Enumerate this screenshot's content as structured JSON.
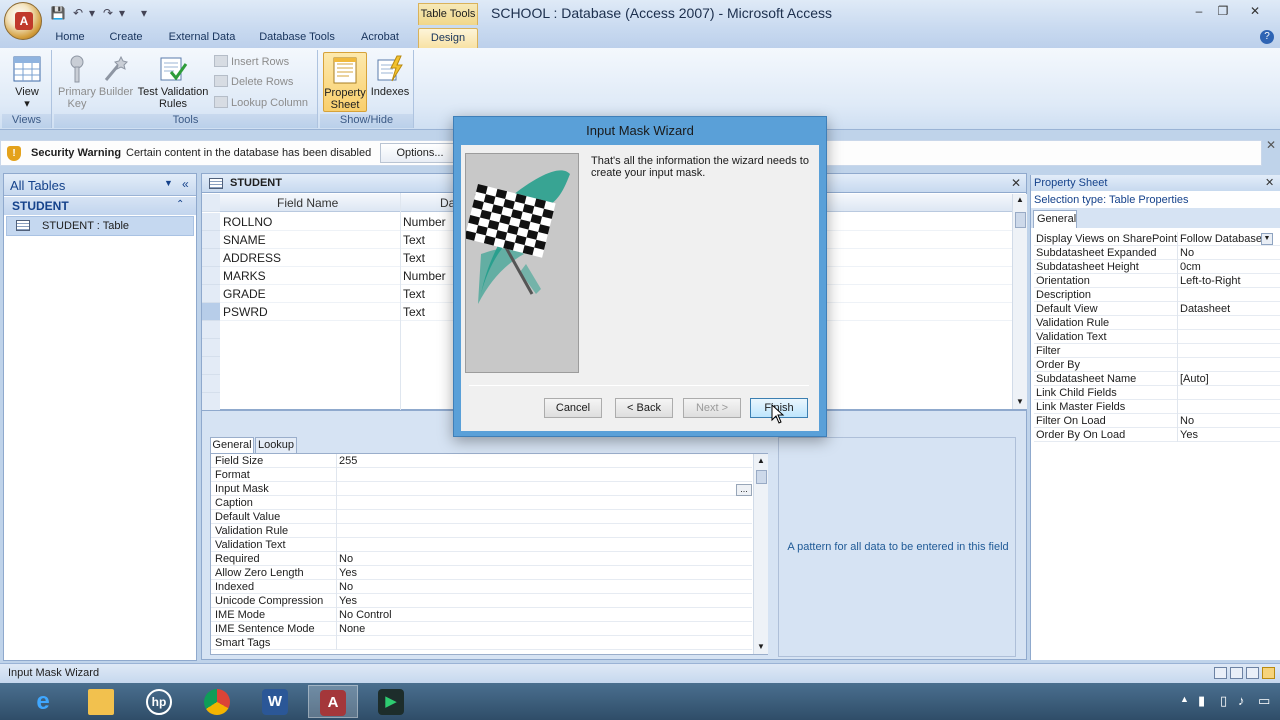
{
  "window": {
    "title": "SCHOOL : Database (Access 2007) - Microsoft Access",
    "context_tab_group": "Table Tools",
    "controls": {
      "minimize": "–",
      "restore": "❐",
      "close": "✕"
    }
  },
  "ribbon": {
    "tabs": [
      "Home",
      "Create",
      "External Data",
      "Database Tools",
      "Acrobat",
      "Design"
    ],
    "active_tab": "Design",
    "groups": {
      "views": {
        "label": "Views",
        "view_button": "View"
      },
      "tools": {
        "label": "Tools",
        "primary_key": [
          "Primary",
          "Key"
        ],
        "builder": "Builder",
        "test_validation": [
          "Test Validation",
          "Rules"
        ],
        "insert_rows": "Insert Rows",
        "delete_rows": "Delete Rows",
        "lookup_column": "Lookup Column"
      },
      "show_hide": {
        "label": "Show/Hide",
        "property_sheet": [
          "Property",
          "Sheet"
        ],
        "indexes": "Indexes"
      }
    }
  },
  "security_bar": {
    "title": "Security Warning",
    "message": "Certain content in the database has been disabled",
    "options_button": "Options..."
  },
  "nav_pane": {
    "title": "All Tables",
    "group": "STUDENT",
    "item": "STUDENT : Table"
  },
  "document": {
    "tab_label": "STUDENT",
    "columns": [
      "Field Name",
      "Da"
    ],
    "rows": [
      {
        "name": "ROLLNO",
        "type": "Number"
      },
      {
        "name": "SNAME",
        "type": "Text"
      },
      {
        "name": "ADDRESS",
        "type": "Text"
      },
      {
        "name": "MARKS",
        "type": "Number"
      },
      {
        "name": "GRADE",
        "type": "Text"
      },
      {
        "name": "PSWRD",
        "type": "Text"
      }
    ]
  },
  "field_properties": {
    "tabs": [
      "General",
      "Lookup"
    ],
    "rows": [
      {
        "name": "Field Size",
        "value": "255"
      },
      {
        "name": "Format",
        "value": ""
      },
      {
        "name": "Input Mask",
        "value": ""
      },
      {
        "name": "Caption",
        "value": ""
      },
      {
        "name": "Default Value",
        "value": ""
      },
      {
        "name": "Validation Rule",
        "value": ""
      },
      {
        "name": "Validation Text",
        "value": ""
      },
      {
        "name": "Required",
        "value": "No"
      },
      {
        "name": "Allow Zero Length",
        "value": "Yes"
      },
      {
        "name": "Indexed",
        "value": "No"
      },
      {
        "name": "Unicode Compression",
        "value": "Yes"
      },
      {
        "name": "IME Mode",
        "value": "No Control"
      },
      {
        "name": "IME Sentence Mode",
        "value": "None"
      },
      {
        "name": "Smart Tags",
        "value": ""
      }
    ],
    "builder_dots": "...",
    "help_text": "A pattern for all data to be entered in this field"
  },
  "property_sheet": {
    "title": "Property Sheet",
    "selection_type": "Selection type:  Table Properties",
    "tab": "General",
    "rows": [
      {
        "name": "Display Views on SharePoint",
        "value": "Follow Database"
      },
      {
        "name": "Subdatasheet Expanded",
        "value": "No"
      },
      {
        "name": "Subdatasheet Height",
        "value": "0cm"
      },
      {
        "name": "Orientation",
        "value": "Left-to-Right"
      },
      {
        "name": "Description",
        "value": ""
      },
      {
        "name": "Default View",
        "value": "Datasheet"
      },
      {
        "name": "Validation Rule",
        "value": ""
      },
      {
        "name": "Validation Text",
        "value": ""
      },
      {
        "name": "Filter",
        "value": ""
      },
      {
        "name": "Order By",
        "value": ""
      },
      {
        "name": "Subdatasheet Name",
        "value": "[Auto]"
      },
      {
        "name": "Link Child Fields",
        "value": ""
      },
      {
        "name": "Link Master Fields",
        "value": ""
      },
      {
        "name": "Filter On Load",
        "value": "No"
      },
      {
        "name": "Order By On Load",
        "value": "Yes"
      }
    ]
  },
  "wizard": {
    "title": "Input Mask Wizard",
    "message": "That's all the information the wizard needs to create your input mask.",
    "buttons": {
      "cancel": "Cancel",
      "back": "< Back",
      "next": "Next >",
      "finish": "Finish"
    }
  },
  "status_bar": {
    "text": "Input Mask Wizard"
  },
  "colors": {
    "accent": "#15428b",
    "wizard_frame": "#5aa0d8",
    "flag_green": "#1f9d8a"
  }
}
